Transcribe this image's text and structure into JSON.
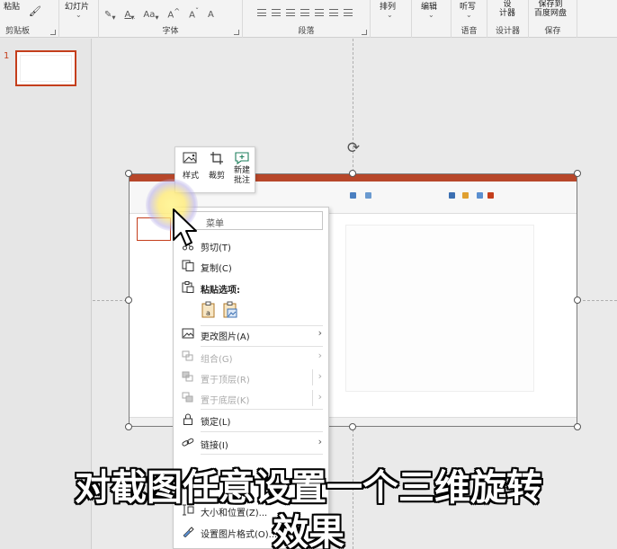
{
  "ribbon": {
    "paste_label": "粘贴",
    "slides_label": "幻灯片",
    "clipboard_group": "剪贴板",
    "font_group": "字体",
    "paragraph_group": "段落",
    "arrange_label": "排列",
    "edit_label": "编辑",
    "dictate_label": "听写",
    "design_label": "设计器",
    "design_btn": "设\n计器",
    "save_btn": "保存到\n百度网盘",
    "voice_group": "语音",
    "designer_group": "设计器",
    "save_group": "保存",
    "font_tools": [
      "A",
      "A",
      "Aa",
      "Aˆ",
      "Aˇ",
      "A"
    ]
  },
  "thumbnails": {
    "number": "1"
  },
  "mini_toolbar": {
    "style_label": "样式",
    "crop_label": "裁剪",
    "new_comment_label": "新建\n批注"
  },
  "context_menu": {
    "search_placeholder": "菜单",
    "items": {
      "cut": "剪切(T)",
      "copy": "复制(C)",
      "paste_options": "粘贴选项:",
      "change_picture": "更改图片(A)",
      "group": "组合(G)",
      "bring_front": "置于顶层(R)",
      "send_back": "置于底层(K)",
      "lock": "锁定(L)",
      "link": "链接(I)",
      "size_position": "大小和位置(Z)...",
      "format_picture": "设置图片格式(O)..."
    }
  },
  "subtitle": {
    "line1": "对截图任意设置一个三维旋转",
    "line2": "效果"
  },
  "colors": {
    "accent": "#c43e1c",
    "ppt_red": "#b7472a"
  }
}
